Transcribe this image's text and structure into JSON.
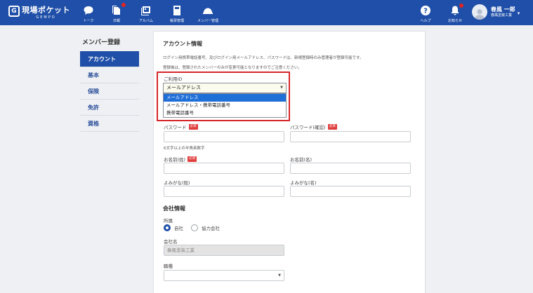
{
  "app": {
    "logo_mark": "G",
    "logo_main": "現場ポケット",
    "logo_sub": "GEMPO"
  },
  "nav": [
    {
      "label": "トーク",
      "icon": "chat-bubble-icon"
    },
    {
      "label": "日報",
      "icon": "document-stack-icon"
    },
    {
      "label": "アルバム",
      "icon": "album-icon"
    },
    {
      "label": "帳票管理",
      "icon": "calculator-icon"
    },
    {
      "label": "メンバー管理",
      "icon": "helmet-icon"
    }
  ],
  "header_right": {
    "help_label": "ヘルプ",
    "notice_label": "お知らせ",
    "user_name": "春風 一郎",
    "user_company": "春風塗装工業",
    "caret": "▾"
  },
  "sidebar": {
    "title": "メンバー登録",
    "items": [
      {
        "label": "アカウント",
        "active": true
      },
      {
        "label": "基本",
        "active": false
      },
      {
        "label": "保険",
        "active": false
      },
      {
        "label": "免許",
        "active": false
      },
      {
        "label": "資格",
        "active": false
      }
    ]
  },
  "account": {
    "title": "アカウント情報",
    "desc1": "ログイン用携帯電話番号、及びログイン用メールアドレス、パスワードは、新規登録時のみ管理者が登録可能です。",
    "desc2": "登録後は、登録されたメンバーのみが変更可能となりますのでご注意ください。",
    "login_id_label": "ご利用ID",
    "login_id_value": "メールアドレス",
    "login_id_options": [
      "メールアドレス",
      "メールアドレス・携帯電話番号",
      "携帯電話番号"
    ],
    "required_badge": "必須",
    "password_label": "パスワード",
    "password_confirm_label": "パスワード(確認)",
    "password_hint": "6文字以上の半角英数字",
    "last_name_label": "お名前(姓)",
    "first_name_label": "お名前(名)",
    "last_kana_label": "よみがな(姓)",
    "first_kana_label": "よみがな(名)"
  },
  "company": {
    "title": "会社情報",
    "affiliation_label": "所属",
    "options": [
      "自社",
      "協力会社"
    ],
    "selected": "自社",
    "company_name_label": "会社名",
    "company_name_value": "春風塗装工業",
    "job_type_label": "職種",
    "job_type_value": ""
  },
  "colors": {
    "header_bg": "#1f4fa8",
    "highlight": "#d6262a",
    "required": "#e03c3c",
    "dropdown_selected": "#1f6fd8"
  }
}
